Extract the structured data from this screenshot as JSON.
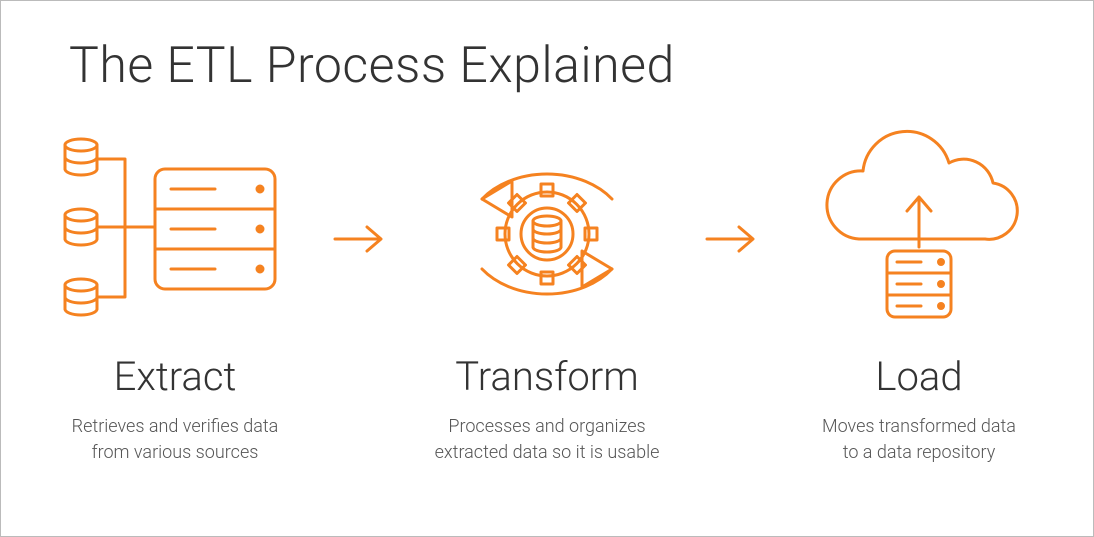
{
  "title": "The ETL Process Explained",
  "accent": "#f58220",
  "steps": [
    {
      "name": "extract",
      "title": "Extract",
      "description": "Retrieves and verifies data\nfrom various sources"
    },
    {
      "name": "transform",
      "title": "Transform",
      "description": "Processes and organizes\nextracted data so it is usable"
    },
    {
      "name": "load",
      "title": "Load",
      "description": "Moves transformed data\nto a data repository"
    }
  ]
}
